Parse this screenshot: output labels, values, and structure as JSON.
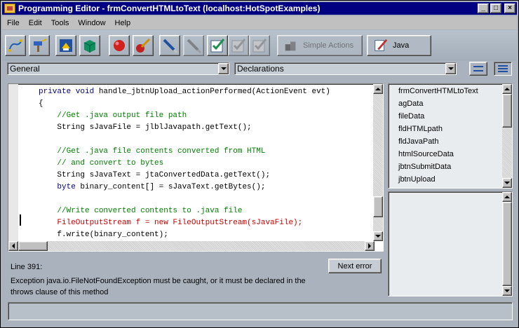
{
  "window": {
    "title": "Programming Editor - frmConvertHTMLtoText  (localhost:HotSpotExamples)",
    "controls": [
      "_",
      "□",
      "×"
    ]
  },
  "menu": [
    "File",
    "Edit",
    "Tools",
    "Window",
    "Help"
  ],
  "toolbar": {
    "icons": [
      "connect-icon",
      "hammer-icon",
      "deploy-icon",
      "module-icon",
      "breakpoint-icon",
      "paint-icon",
      "pen-icon",
      "pen-disabled-icon",
      "check-icon",
      "check-disabled-icon",
      "check-disabled-icon"
    ],
    "simple_actions_label": "Simple Actions",
    "java_label": "Java"
  },
  "combos": {
    "object": "General",
    "procedure": "Declarations"
  },
  "code_lines": [
    {
      "indent": "",
      "parts": [
        {
          "t": "private void ",
          "c": "kw"
        },
        {
          "t": "handle_jbtnUpload_actionPerformed(ActionEvent evt)",
          "c": ""
        }
      ]
    },
    {
      "indent": "",
      "parts": [
        {
          "t": "{",
          "c": ""
        }
      ]
    },
    {
      "indent": "    ",
      "parts": [
        {
          "t": "//Get .java output file path",
          "c": "cm"
        }
      ]
    },
    {
      "indent": "    ",
      "parts": [
        {
          "t": "String sJavaFile = jlblJavapath.getText();",
          "c": ""
        }
      ]
    },
    {
      "indent": "",
      "parts": [
        {
          "t": "",
          "c": ""
        }
      ]
    },
    {
      "indent": "    ",
      "parts": [
        {
          "t": "//Get .java file contents converted from HTML",
          "c": "cm"
        }
      ]
    },
    {
      "indent": "    ",
      "parts": [
        {
          "t": "// and convert to bytes",
          "c": "cm"
        }
      ]
    },
    {
      "indent": "    ",
      "parts": [
        {
          "t": "String sJavaText = jtaConvertedData.getText();",
          "c": ""
        }
      ]
    },
    {
      "indent": "    ",
      "parts": [
        {
          "t": "byte ",
          "c": "kw"
        },
        {
          "t": "binary_content[] = sJavaText.getBytes();",
          "c": ""
        }
      ]
    },
    {
      "indent": "",
      "parts": [
        {
          "t": "",
          "c": ""
        }
      ]
    },
    {
      "indent": "    ",
      "parts": [
        {
          "t": "//Write converted contents to .java file",
          "c": "cm"
        }
      ]
    },
    {
      "indent": "    ",
      "parts": [
        {
          "t": "FileOutputStream f = new FileOutputStream(sJavaFile);",
          "c": "err"
        }
      ]
    },
    {
      "indent": "    ",
      "parts": [
        {
          "t": "f.write(binary_content);",
          "c": ""
        }
      ]
    }
  ],
  "members": [
    "frmConvertHTMLtoText",
    "agData",
    "fileData",
    "fldHTMLpath",
    "fldJavaPath",
    "htmlSourceData",
    "jbtnSubmitData",
    "jbtnUpload"
  ],
  "errors": {
    "line": "Line 391:",
    "message": "Exception java.io.FileNotFoundException must be caught, or it must be declared in the throws clause of this method",
    "next_label": "Next error"
  },
  "colors": {
    "keyword": "#000080",
    "comment": "#008000",
    "error": "#cc0000",
    "titlebar": "#000080"
  }
}
